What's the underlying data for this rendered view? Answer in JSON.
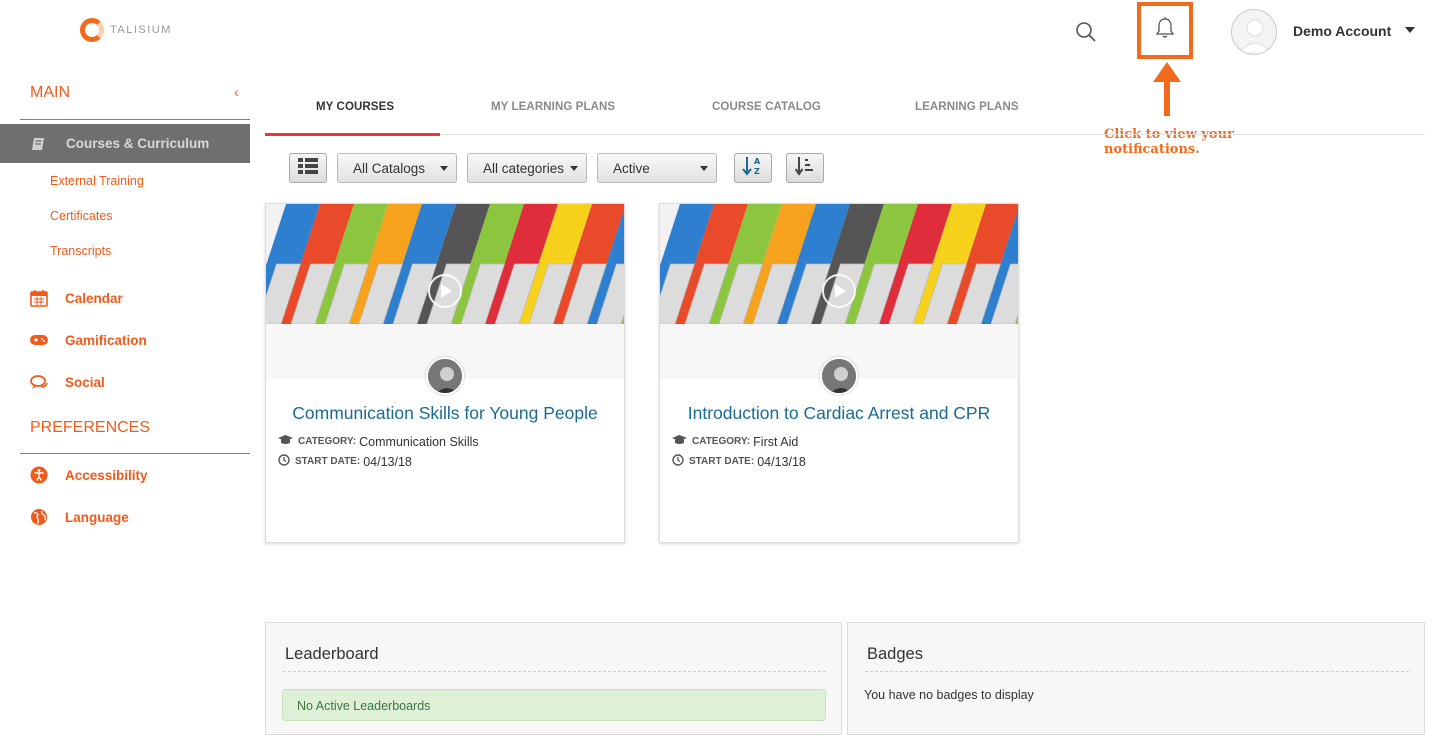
{
  "brand": {
    "name": "TALISIUM",
    "accent": "#f05a1a",
    "highlight": "#f26a1b"
  },
  "topbar": {
    "search_icon": "search-icon",
    "notifications_icon": "bell-icon",
    "account_name": "Demo Account"
  },
  "callout": {
    "text": "Click to view your notifications."
  },
  "sidebar": {
    "main_heading": "MAIN",
    "active_item": {
      "label": "Courses & Curriculum",
      "icon": "book-icon"
    },
    "sub_items": [
      {
        "label": "External Training"
      },
      {
        "label": "Certificates"
      },
      {
        "label": "Transcripts"
      }
    ],
    "items": [
      {
        "label": "Calendar",
        "icon": "calendar-icon"
      },
      {
        "label": "Gamification",
        "icon": "gamepad-icon"
      },
      {
        "label": "Social",
        "icon": "chat-icon"
      }
    ],
    "preferences_heading": "PREFERENCES",
    "preference_items": [
      {
        "label": "Accessibility",
        "icon": "accessibility-icon"
      },
      {
        "label": "Language",
        "icon": "globe-icon"
      }
    ]
  },
  "tabs": [
    {
      "label": "MY COURSES",
      "active": true
    },
    {
      "label": "MY LEARNING PLANS",
      "active": false
    },
    {
      "label": "COURSE CATALOG",
      "active": false
    },
    {
      "label": "LEARNING PLANS",
      "active": false
    }
  ],
  "toolbar": {
    "view_toggle_icon": "list-view-icon",
    "catalog_filter": "All Catalogs",
    "category_filter": "All categories",
    "status_filter": "Active",
    "sort_alpha_icon": "sort-alpha-icon",
    "sort_order_icon": "sort-order-icon"
  },
  "courses": [
    {
      "title": "Communication Skills for Young People",
      "category_key": "CATEGORY:",
      "category": "Communication Skills",
      "start_key": "START DATE:",
      "start_date": "04/13/18"
    },
    {
      "title": "Introduction to Cardiac Arrest and CPR",
      "category_key": "CATEGORY:",
      "category": "First Aid",
      "start_key": "START DATE:",
      "start_date": "04/13/18"
    }
  ],
  "leaderboard": {
    "title": "Leaderboard",
    "message": "No Active Leaderboards"
  },
  "badges": {
    "title": "Badges",
    "message": "You have no badges to display"
  }
}
